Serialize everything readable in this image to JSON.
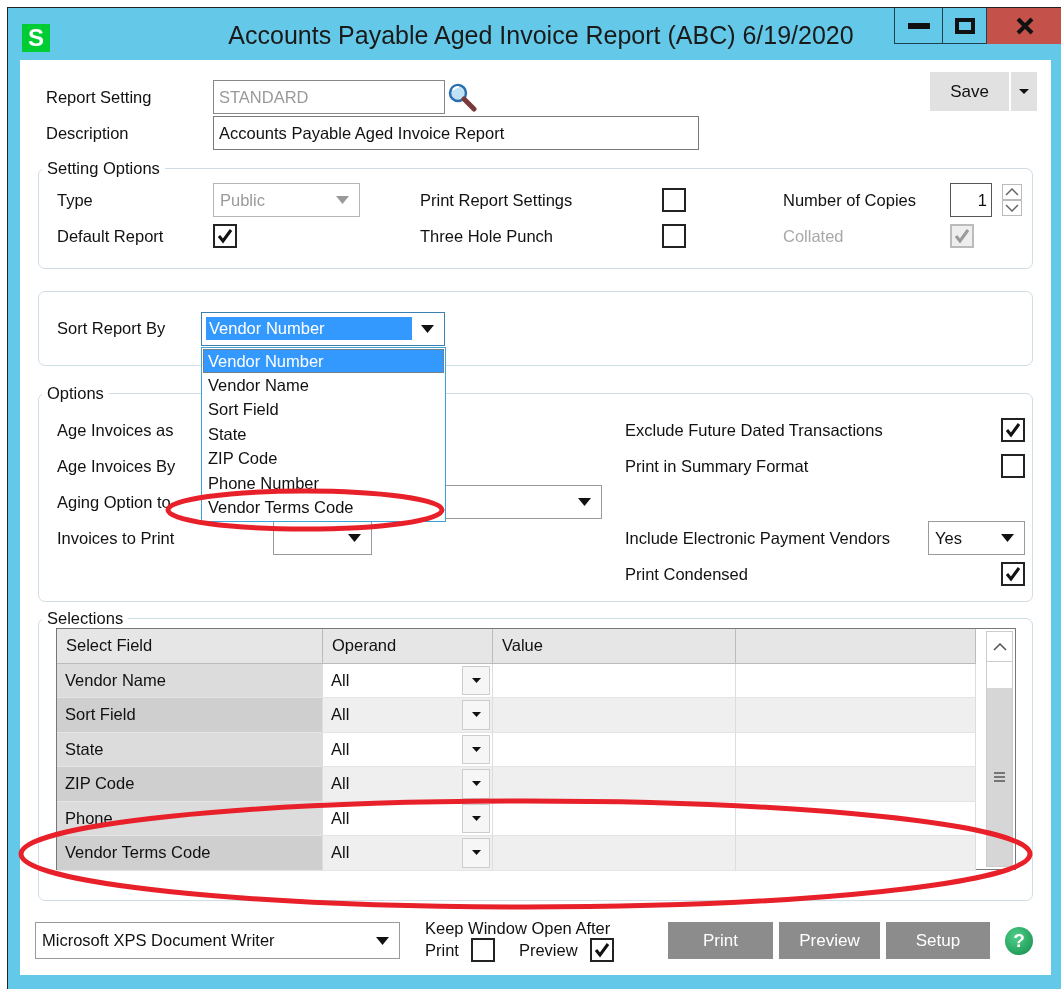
{
  "window": {
    "app_icon": "S",
    "title": "Accounts Payable Aged Invoice Report (ABC) 6/19/2020"
  },
  "header": {
    "report_setting": {
      "label": "Report Setting",
      "value": "STANDARD",
      "disabled": true
    },
    "description": {
      "label": "Description",
      "value": "Accounts Payable Aged Invoice Report"
    },
    "save_button": "Save"
  },
  "setting_options": {
    "legend": "Setting Options",
    "type": {
      "label": "Type",
      "value": "Public",
      "disabled": true
    },
    "default_report": {
      "label": "Default Report",
      "checked": true,
      "disabled": false
    },
    "print_report_settings": {
      "label": "Print Report Settings",
      "checked": false,
      "disabled": false
    },
    "three_hole_punch": {
      "label": "Three Hole Punch",
      "checked": false,
      "disabled": false
    },
    "copies": {
      "label": "Number of Copies",
      "value": "1"
    },
    "collated": {
      "label": "Collated",
      "checked": true,
      "disabled": true
    }
  },
  "sort": {
    "label": "Sort Report By",
    "value": "Vendor Number",
    "expanded": true,
    "options": [
      {
        "label": "Vendor Number",
        "selected": true
      },
      {
        "label": "Vendor Name",
        "selected": false
      },
      {
        "label": "Sort Field",
        "selected": false
      },
      {
        "label": "State",
        "selected": false
      },
      {
        "label": "ZIP Code",
        "selected": false
      },
      {
        "label": "Phone Number",
        "selected": false
      },
      {
        "label": "Vendor Terms Code",
        "selected": false
      }
    ]
  },
  "options": {
    "legend": "Options",
    "left": [
      {
        "kind": "label",
        "label": "Age Invoices as"
      },
      {
        "kind": "label",
        "label": "Age Invoices By"
      },
      {
        "kind": "select",
        "label": "Aging Option to"
      },
      {
        "kind": "select",
        "label": "Invoices to Print"
      }
    ],
    "right": [
      {
        "kind": "checkbox",
        "label": "Exclude Future Dated Transactions",
        "checked": true
      },
      {
        "kind": "checkbox",
        "label": "Print in Summary Format",
        "checked": false
      },
      {
        "kind": "blank"
      },
      {
        "kind": "select",
        "label": "Include Electronic Payment Vendors",
        "value": "Yes"
      },
      {
        "kind": "checkbox",
        "label": "Print Condensed",
        "checked": true
      }
    ]
  },
  "selections": {
    "legend": "Selections",
    "columns": [
      "Select Field",
      "Operand",
      "Value"
    ],
    "rows": [
      {
        "field": "Vendor Name",
        "operand": "All"
      },
      {
        "field": "Sort Field",
        "operand": "All"
      },
      {
        "field": "State",
        "operand": "All"
      },
      {
        "field": "ZIP Code",
        "operand": "All"
      },
      {
        "field": "Phone",
        "operand": "All"
      },
      {
        "field": "Vendor Terms Code",
        "operand": "All"
      }
    ]
  },
  "footer": {
    "printer": "Microsoft XPS Document Writer",
    "keep_open_label": "Keep Window Open After",
    "keep_open": [
      {
        "label": "Print",
        "checked": false
      },
      {
        "label": "Preview",
        "checked": true
      }
    ],
    "buttons": [
      "Print",
      "Preview",
      "Setup"
    ],
    "help": "?"
  },
  "annotations": [
    {
      "kind": "ellipse"
    },
    {
      "kind": "ellipse"
    }
  ]
}
